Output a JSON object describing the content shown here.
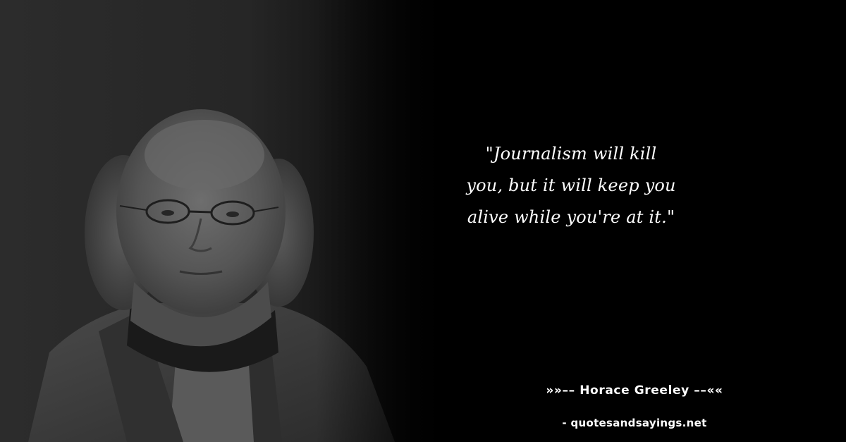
{
  "quote": {
    "text": "\"Journalism will kill you, but it will keep you alive while you're at it.\""
  },
  "attribution": {
    "author_line": "»»–– Horace Greeley ––««",
    "source": "- quotesandsayings.net"
  },
  "colors": {
    "background": "#000000",
    "text": "#ffffff"
  }
}
